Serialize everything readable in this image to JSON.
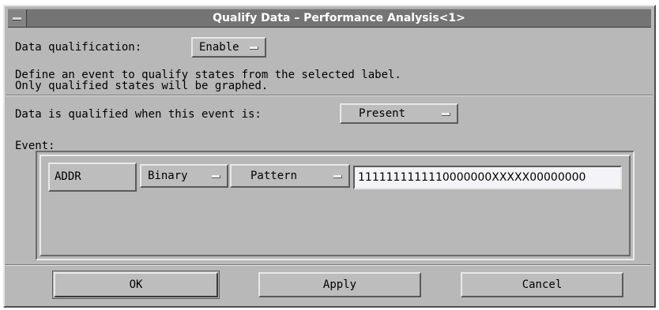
{
  "window": {
    "title": "Qualify Data – Performance Analysis<1>"
  },
  "qualification": {
    "label": "Data qualification:",
    "selected": "Enable"
  },
  "description": {
    "line1": "Define an event to qualify states from the selected label.",
    "line2": "Only qualified states will be graphed."
  },
  "condition": {
    "label": "Data is qualified when this event is:",
    "selected": "Present"
  },
  "event": {
    "label": "Event:",
    "label_button": "ADDR",
    "base": "Binary",
    "mode": "Pattern",
    "pattern_value": "1111111111110000000XXXXX00000000"
  },
  "actions": {
    "ok": "OK",
    "apply": "Apply",
    "cancel": "Cancel"
  },
  "colors": {
    "background": "#b8b8b8",
    "titlebar": "#747474",
    "field": "#f4f4f8"
  },
  "icons": {
    "window_menu": "window-menu-icon",
    "option_indicator": "option-menu-indicator-icon"
  }
}
